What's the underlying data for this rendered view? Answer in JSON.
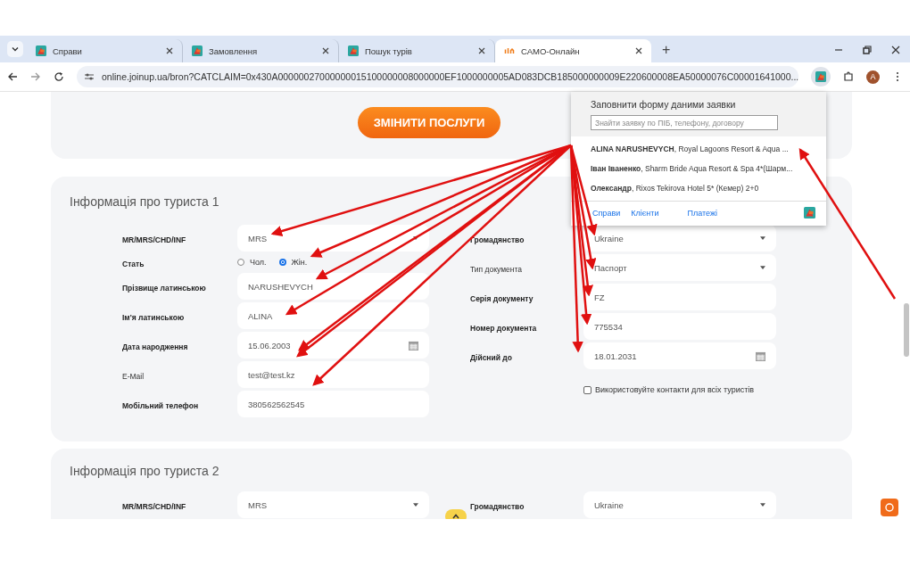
{
  "browser": {
    "tabs": [
      {
        "title": "Справи",
        "selected": false,
        "kind": "app"
      },
      {
        "title": "Замовлення",
        "selected": false,
        "kind": "app"
      },
      {
        "title": "Пошук турів",
        "selected": false,
        "kind": "app"
      },
      {
        "title": "САМО-Онлайн",
        "selected": true,
        "kind": "samo"
      }
    ],
    "new_tab": "+",
    "address": "online.joinup.ua/bron?CATCLAIM=0x430A00000027000000015100000008000000EF1000000005AD083DCB185000000009E220600008EA50000076C00001641000...",
    "avatar": "A"
  },
  "page": {
    "change_button": "ЗМІНИТИ ПОСЛУГИ",
    "tourists": [
      {
        "title": "Інформація про туриста 1",
        "left_fields": [
          {
            "kind": "select",
            "label": "MR/MRS/CHD/INF",
            "required": true,
            "value": "MRS"
          },
          {
            "kind": "radio",
            "label": "Стать",
            "required": true,
            "options": [
              {
                "label": "Чол.",
                "selected": false
              },
              {
                "label": "Жін.",
                "selected": true
              }
            ]
          },
          {
            "kind": "text",
            "label": "Прізвище латинською",
            "required": true,
            "value": "NARUSHEVYCH"
          },
          {
            "kind": "text",
            "label": "Ім'я латинською",
            "required": true,
            "value": "ALINA"
          },
          {
            "kind": "date",
            "label": "Дата народження",
            "required": true,
            "value": "15.06.2003"
          },
          {
            "kind": "text",
            "label": "E-Mail",
            "required": false,
            "value": "test@test.kz"
          },
          {
            "kind": "text",
            "label": "Мобільний телефон",
            "required": true,
            "value": "380562562545"
          }
        ],
        "right_fields": [
          {
            "kind": "select",
            "label": "Громадянство",
            "required": true,
            "value": "Ukraine"
          },
          {
            "kind": "select",
            "label": "Тип документа",
            "required": false,
            "value": "Паспорт"
          },
          {
            "kind": "text",
            "label": "Серія документу",
            "required": true,
            "value": "FZ"
          },
          {
            "kind": "text",
            "label": "Номер документа",
            "required": true,
            "value": "775534"
          },
          {
            "kind": "date",
            "label": "Дійсний до",
            "required": true,
            "value": "18.01.2031"
          }
        ],
        "contact_checkbox": {
          "label": "Використовуйте контакти для всіх туристів",
          "checked": false
        }
      },
      {
        "title": "Інформація про туриста 2",
        "left_fields": [
          {
            "kind": "select",
            "label": "MR/MRS/CHD/INF",
            "required": true,
            "value": "MRS"
          }
        ],
        "right_fields": [
          {
            "kind": "select",
            "label": "Громадянство",
            "required": true,
            "value": "Ukraine"
          }
        ]
      }
    ]
  },
  "extension_popup": {
    "title": "Заповнити форму даними заявки",
    "search": {
      "placeholder": "Знайти заявку по ПІБ, телефону, договору"
    },
    "results": [
      "**ALINA NARUSHEVYCH**, Royal Lagoons Resort & Aqua ...",
      "**Іван Іваненко**, Sharm Bride Aqua Resort & Spa 4*(Шарм...",
      "**Олександр**, Rixos Tekirova Hotel 5* (Кемер) 2+0"
    ],
    "links": [
      "Справи",
      "Клієнти",
      "Платежі"
    ]
  }
}
